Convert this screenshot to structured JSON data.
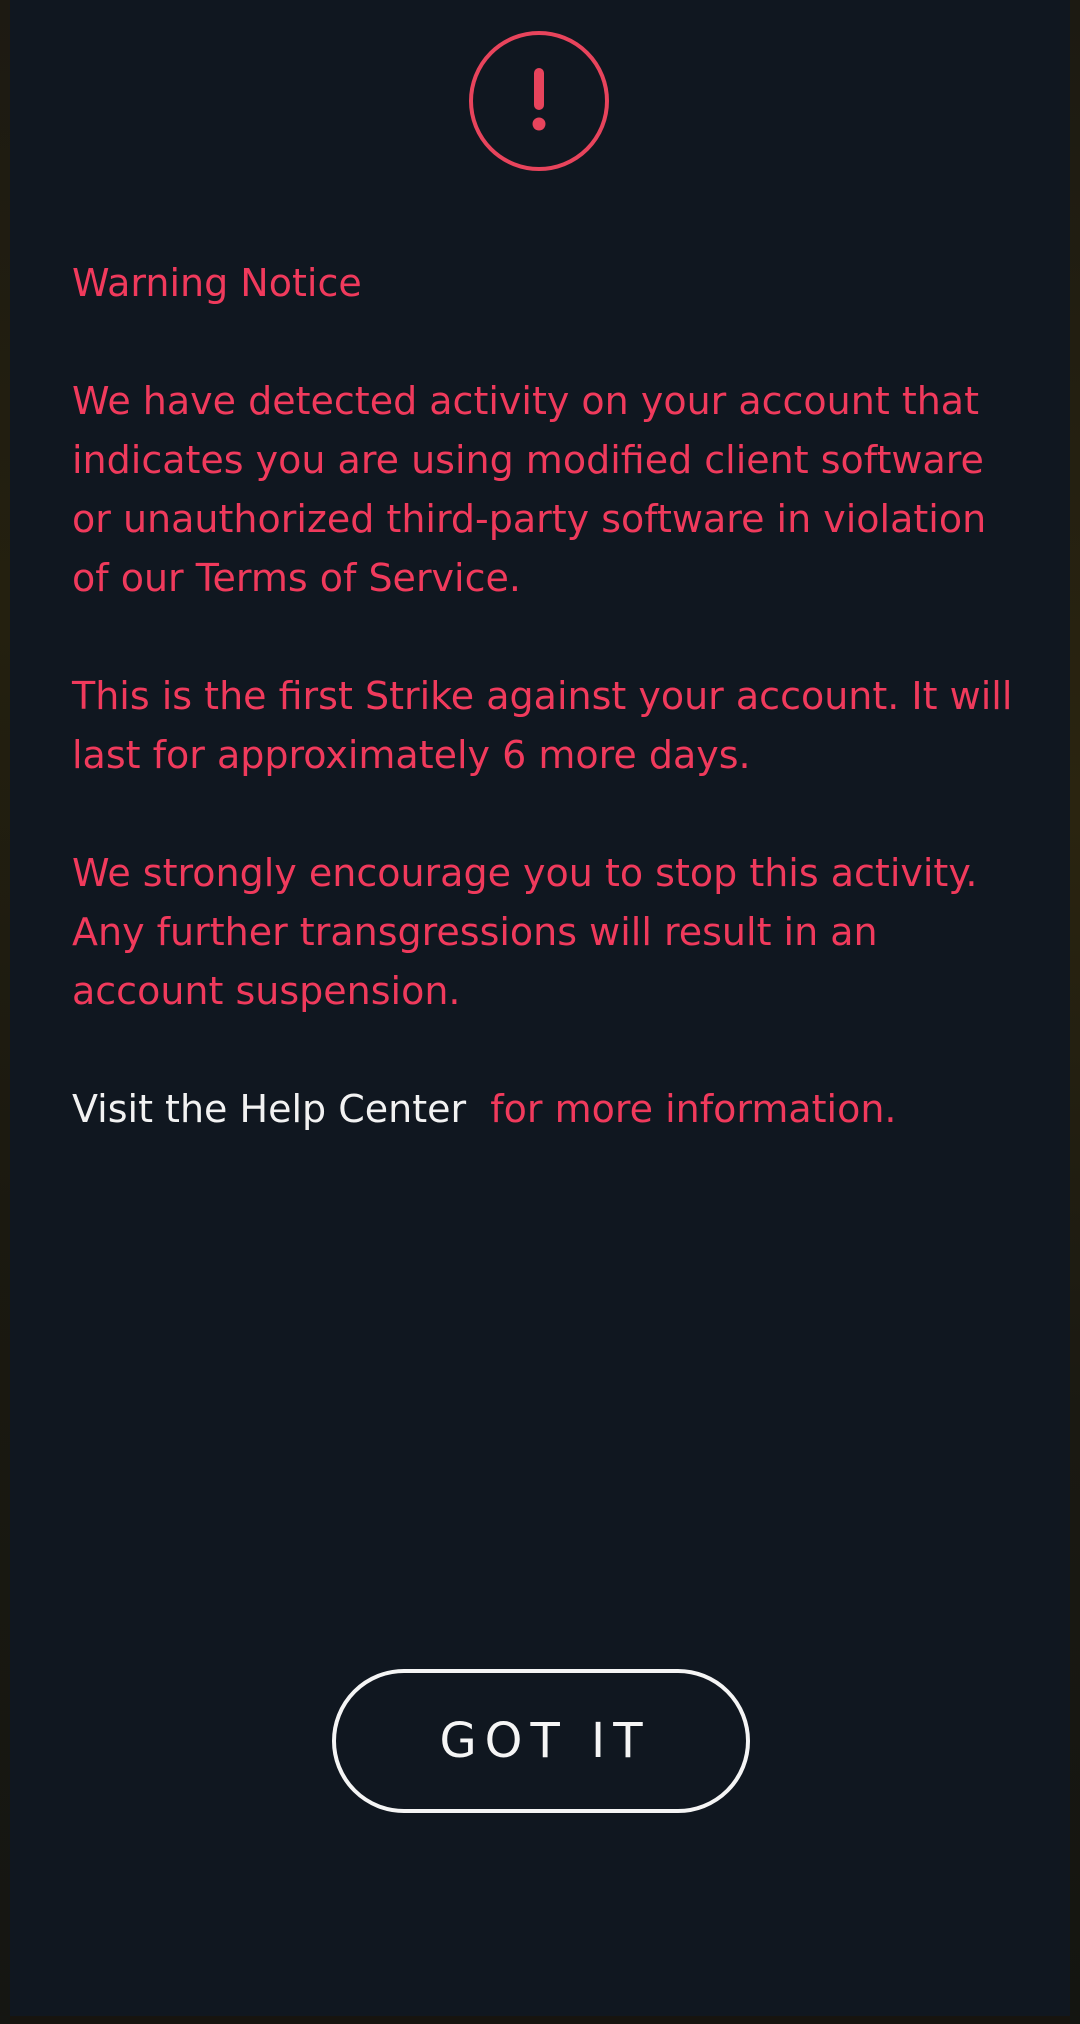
{
  "dialog": {
    "icon": "exclamation-icon",
    "accent_color": "#e8445c",
    "title": "Warning Notice",
    "paragraph_1": "We have detected activity on your account that indicates you are using modified client software or unauthorized third-party software in violation of our ",
    "terms_link": "Terms of Service",
    "paragraph_1_end": ".",
    "paragraph_2": "This is the first Strike against your account. It will last for approximately 6 more days.",
    "paragraph_3": "We strongly encourage you to stop this activity. Any further transgressions will result in an account suspension.",
    "help_link": "Visit the Help Center",
    "help_suffix": "  for more information.",
    "button_label": "GOT IT"
  }
}
